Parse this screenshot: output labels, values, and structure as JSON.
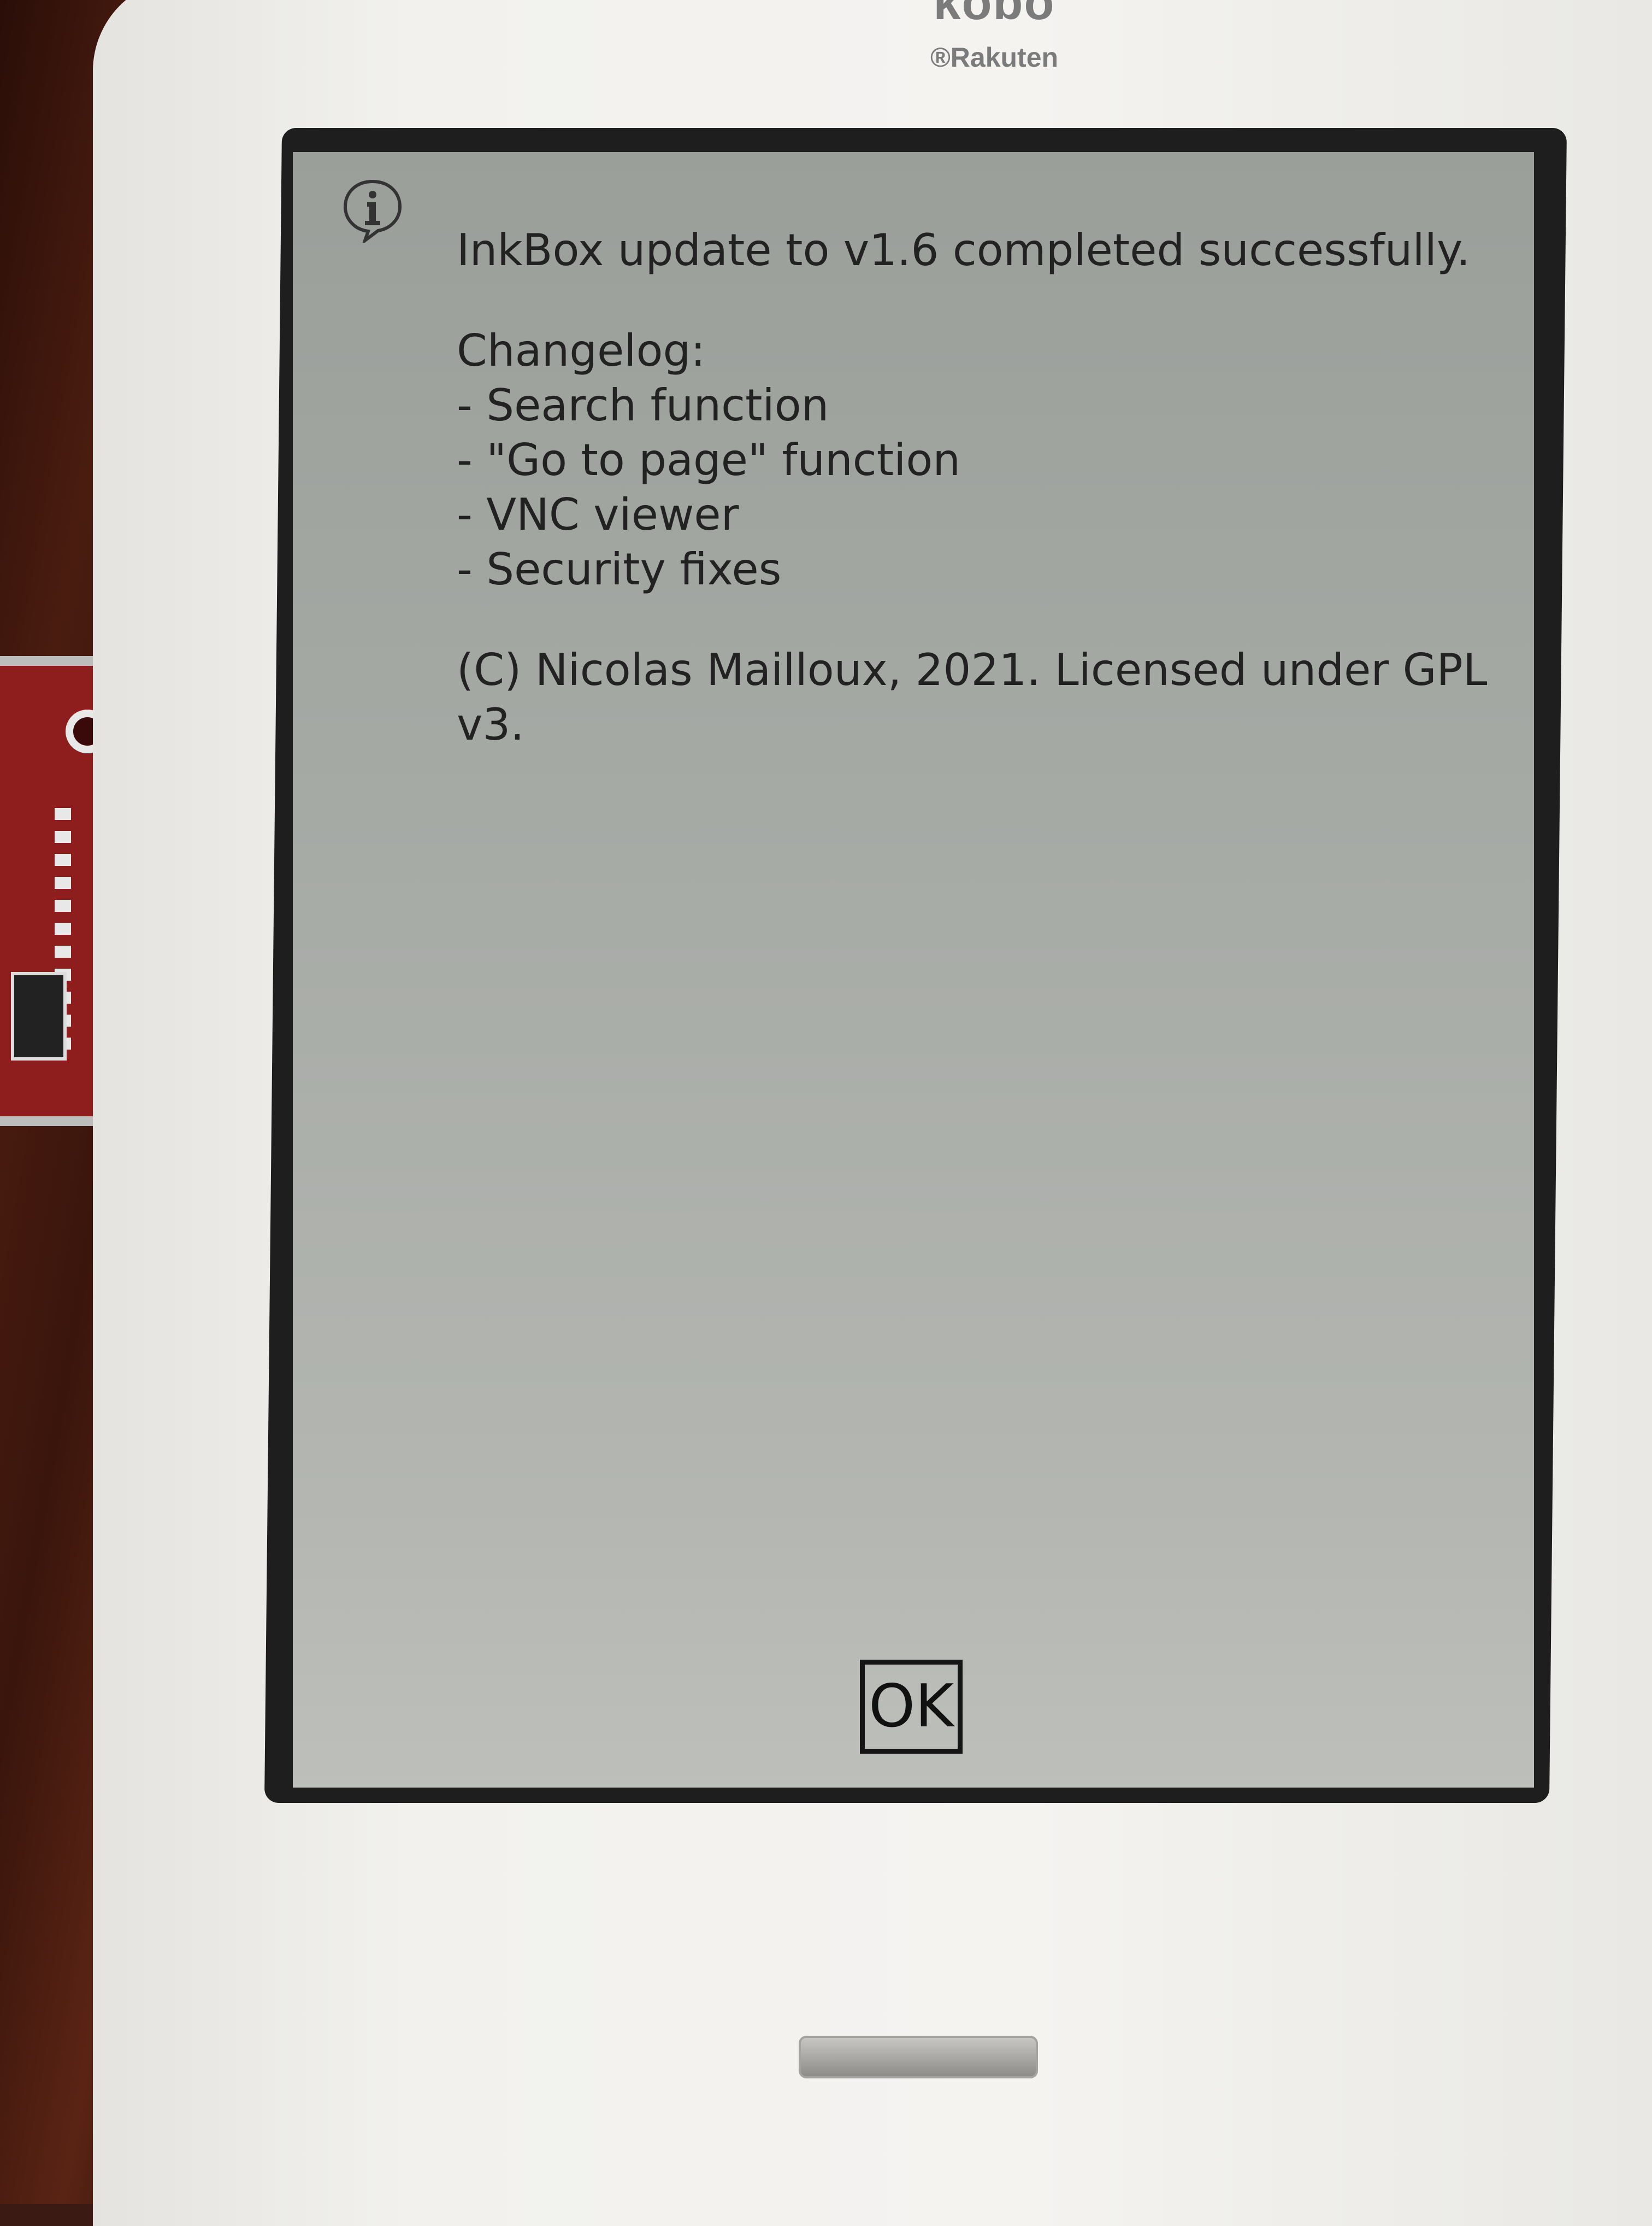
{
  "device": {
    "brand_name": "kobo",
    "brand_sub": "®Rakuten"
  },
  "dialog": {
    "icon": "info-icon",
    "title_line": "InkBox update to v1.6 completed successfully.",
    "changelog_heading": "Changelog:",
    "changelog_items": [
      "- Search function",
      "- \"Go to page\" function",
      "- VNC viewer",
      "- Security fixes"
    ],
    "license_line_1": "(C) Nicolas Mailloux, 2021. Licensed under GPL",
    "license_line_2": "v3.",
    "ok_label": "OK"
  },
  "colors": {
    "screen": "#a6aaa5",
    "text": "#222222",
    "bezel": "#1e1e1e",
    "device_body": "#f2f1ee"
  }
}
